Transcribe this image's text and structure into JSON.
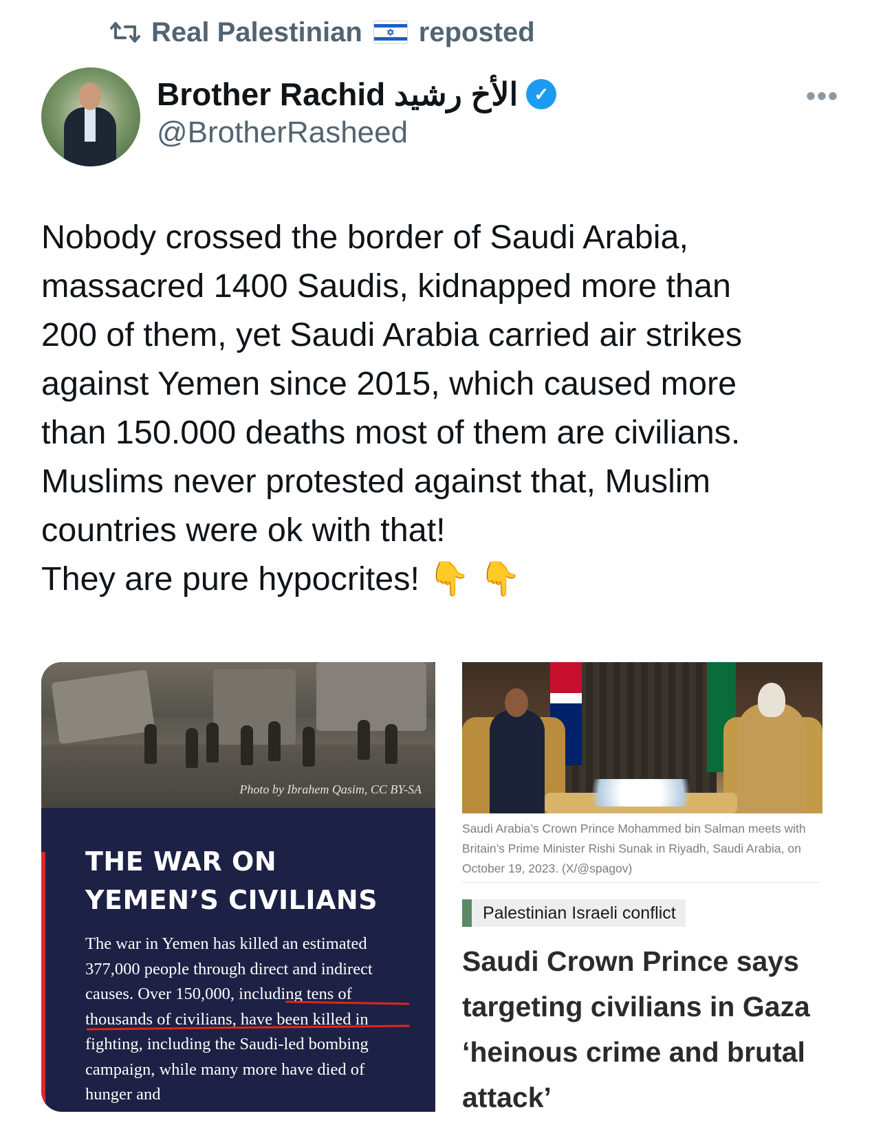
{
  "repost": {
    "text": "Real Palestinian",
    "flag": "🇮🇱",
    "suffix": "reposted",
    "icon": "repost-icon"
  },
  "author": {
    "display_name": "Brother Rachid الأخ رشيد",
    "handle": "@BrotherRasheed",
    "verified": true
  },
  "tweet": {
    "text": "Nobody crossed the border of Saudi Arabia,\nmassacred 1400 Saudis, kidnapped more than\n200 of them, yet Saudi Arabia carried air strikes\nagainst Yemen since 2015, which caused more\nthan 150.000 deaths most of them are civilians.\nMuslims never protested against that, Muslim\ncountries were ok with that!\nThey are pure hypocrites! 👇 👇"
  },
  "media_left": {
    "photo_credit": "Photo by Ibrahem Qasim, CC BY-SA",
    "title": "THE WAR ON YEMEN’S CIVILIANS",
    "body": "The war in Yemen has killed an estimated 377,000 people through direct and indirect causes. Over 150,000, including tens of thousands of civilians, have been killed in fighting, including the Saudi-led bombing campaign, while many more have died of hunger and"
  },
  "media_right": {
    "caption": "Saudi Arabia’s Crown Prince Mohammed bin Salman meets with Britain’s Prime Minister Rishi Sunak in Riyadh, Saudi Arabia, on October 19, 2023. (X/@spagov)",
    "tag": "Palestinian Israeli conflict",
    "headline": "Saudi Crown Prince says targeting civilians in Gaza ‘heinous crime and brutal attack’"
  },
  "colors": {
    "verified_blue": "#1d9bf0",
    "secondary_text": "#536471",
    "card_navy": "#1d2145",
    "accent_red": "#d52b2b",
    "tag_green": "#5a8a66"
  }
}
